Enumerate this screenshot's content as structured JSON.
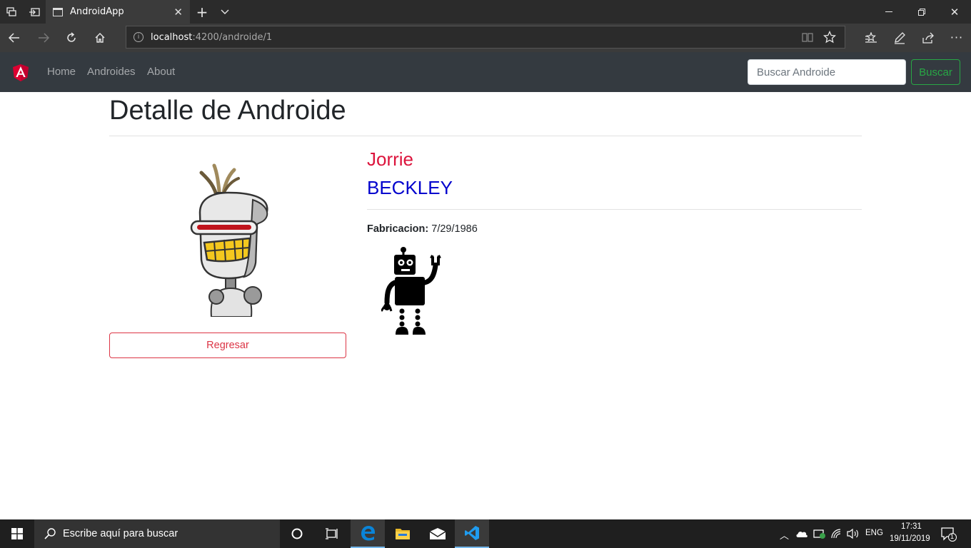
{
  "browser": {
    "tab_title": "AndroidApp",
    "url_host": "localhost",
    "url_path": ":4200/androide/1"
  },
  "navbar": {
    "links": [
      "Home",
      "Androides",
      "About"
    ],
    "search_placeholder": "Buscar Androide",
    "search_button": "Buscar",
    "brand_color": "#dd0031",
    "search_button_color": "#28a745"
  },
  "detail": {
    "page_title": "Detalle de Androide",
    "first_name": "Jorrie",
    "first_name_color": "#dc143c",
    "last_name": "BECKLEY",
    "last_name_color": "#0000cd",
    "fabricacion_label": "Fabricacion:",
    "fabricacion_value": "7/29/1986",
    "back_button": "Regresar",
    "back_button_color": "#dc3545"
  },
  "taskbar": {
    "search_placeholder": "Escribe aquí para buscar",
    "language": "ENG",
    "time": "17:31",
    "date": "19/11/2019",
    "notification_count": "1"
  }
}
